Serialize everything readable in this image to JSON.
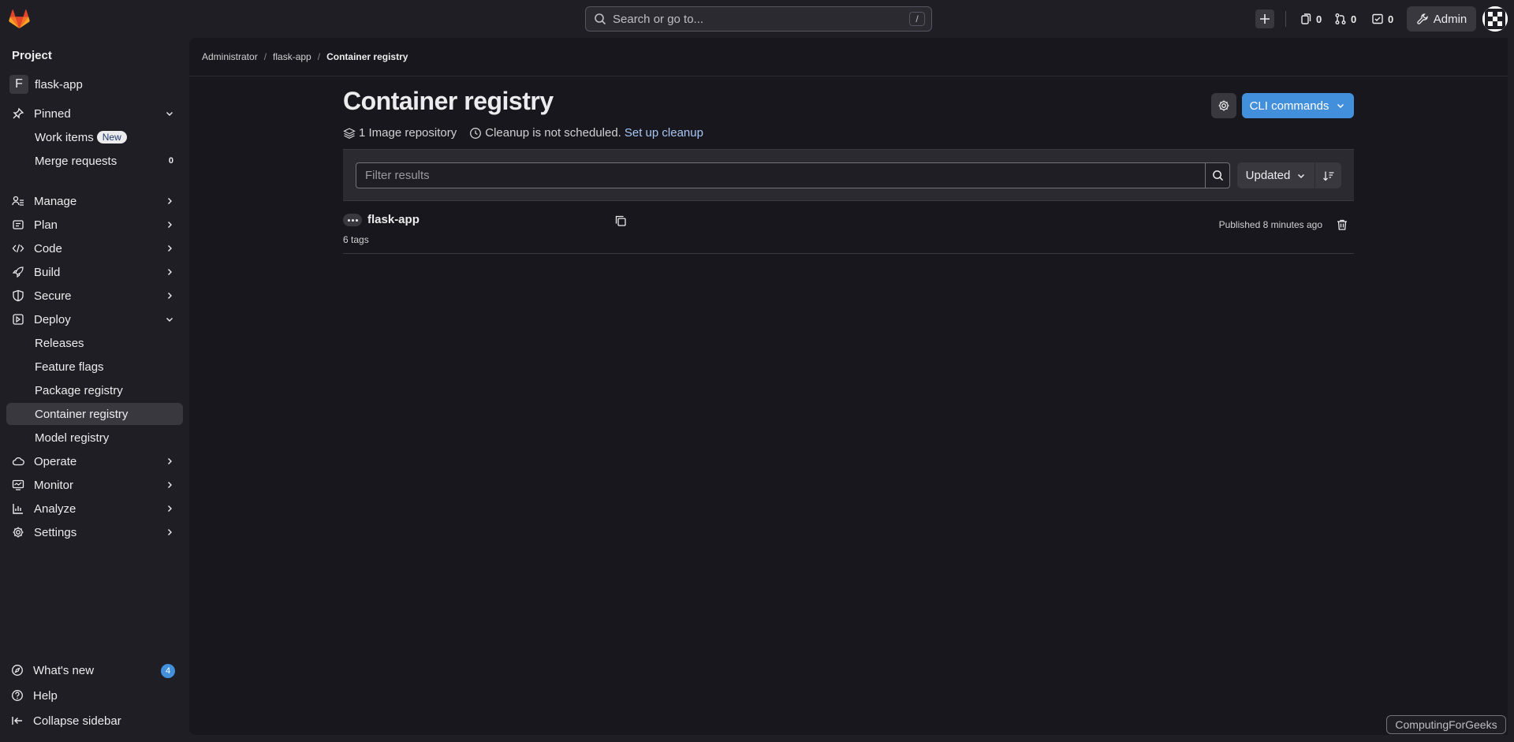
{
  "topbar": {
    "search_placeholder": "Search or go to...",
    "search_shortcut": "/",
    "issues_count": "0",
    "merge_requests_count": "0",
    "todos_count": "0",
    "admin_label": "Admin"
  },
  "sidebar": {
    "title": "Project",
    "project_initial": "F",
    "project_name": "flask-app",
    "pinned_label": "Pinned",
    "pinned_items": [
      {
        "label": "Work items",
        "badge": "New"
      },
      {
        "label": "Merge requests",
        "count": "0"
      }
    ],
    "sections": [
      {
        "label": "Manage",
        "icon": "manage-icon"
      },
      {
        "label": "Plan",
        "icon": "plan-icon"
      },
      {
        "label": "Code",
        "icon": "code-icon"
      },
      {
        "label": "Build",
        "icon": "rocket-icon"
      },
      {
        "label": "Secure",
        "icon": "shield-icon"
      },
      {
        "label": "Deploy",
        "icon": "deploy-icon"
      }
    ],
    "deploy_items": [
      "Releases",
      "Feature flags",
      "Package registry",
      "Container registry",
      "Model registry"
    ],
    "more_sections": [
      {
        "label": "Operate",
        "icon": "cloud-icon"
      },
      {
        "label": "Monitor",
        "icon": "monitor-icon"
      },
      {
        "label": "Analyze",
        "icon": "chart-icon"
      },
      {
        "label": "Settings",
        "icon": "gear-icon"
      }
    ],
    "footer": {
      "whats_new": "What's new",
      "whats_new_count": "4",
      "help": "Help",
      "collapse": "Collapse sidebar"
    }
  },
  "breadcrumb": [
    "Administrator",
    "flask-app",
    "Container registry"
  ],
  "page": {
    "title": "Container registry",
    "cli_button": "CLI commands",
    "image_repos": "1 Image repository",
    "cleanup_text": "Cleanup is not scheduled.",
    "cleanup_link": "Set up cleanup",
    "filter_placeholder": "Filter results",
    "sort_label": "Updated"
  },
  "repositories": [
    {
      "name": "flask-app",
      "tags": "6 tags",
      "published": "Published 8 minutes ago"
    }
  ],
  "watermark": "ComputingForGeeks",
  "colors": {
    "accent": "#428fdc",
    "background": "#1f1e24",
    "panel": "#18171d"
  }
}
